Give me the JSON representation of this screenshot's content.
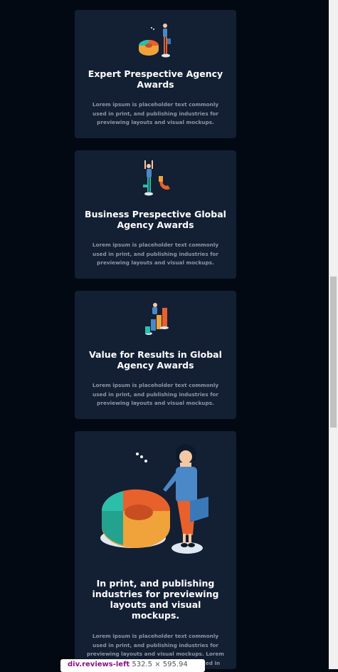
{
  "cards": [
    {
      "title": "Expert Prespective Agency Awards",
      "description": "Lorem ipsum is placeholder text commonly used in print, and publishing industries for previewing layouts and visual mockups.",
      "icon": "pie-chart-person-icon"
    },
    {
      "title": "Business Prespective Global Agency Awards",
      "description": "Lorem ipsum is placeholder text commonly used in print, and publishing industries for previewing layouts and visual mockups.",
      "icon": "magnet-person-icon"
    },
    {
      "title": "Value for Results in Global Agency Awards",
      "description": "Lorem ipsum is placeholder text commonly used in print, and publishing industries for previewing layouts and visual mockups.",
      "icon": "bar-chart-person-icon"
    },
    {
      "title": "In print, and publishing industries for previewing layouts and visual mockups.",
      "description": "Lorem ipsum is placeholder text commonly used in print, and publishing industries for previewing layouts and visual mockups. Lorem ipsum is placeholder text commonly used in",
      "icon": "large-pie-chart-person-illustration"
    }
  ],
  "tooltip": {
    "tag": "div.reviews-left",
    "dims": "532.5 × 595.94"
  },
  "colors": {
    "page_bg": "#020913",
    "card_bg": "#131f33",
    "title": "#ffffff",
    "desc": "#8e96a6"
  }
}
